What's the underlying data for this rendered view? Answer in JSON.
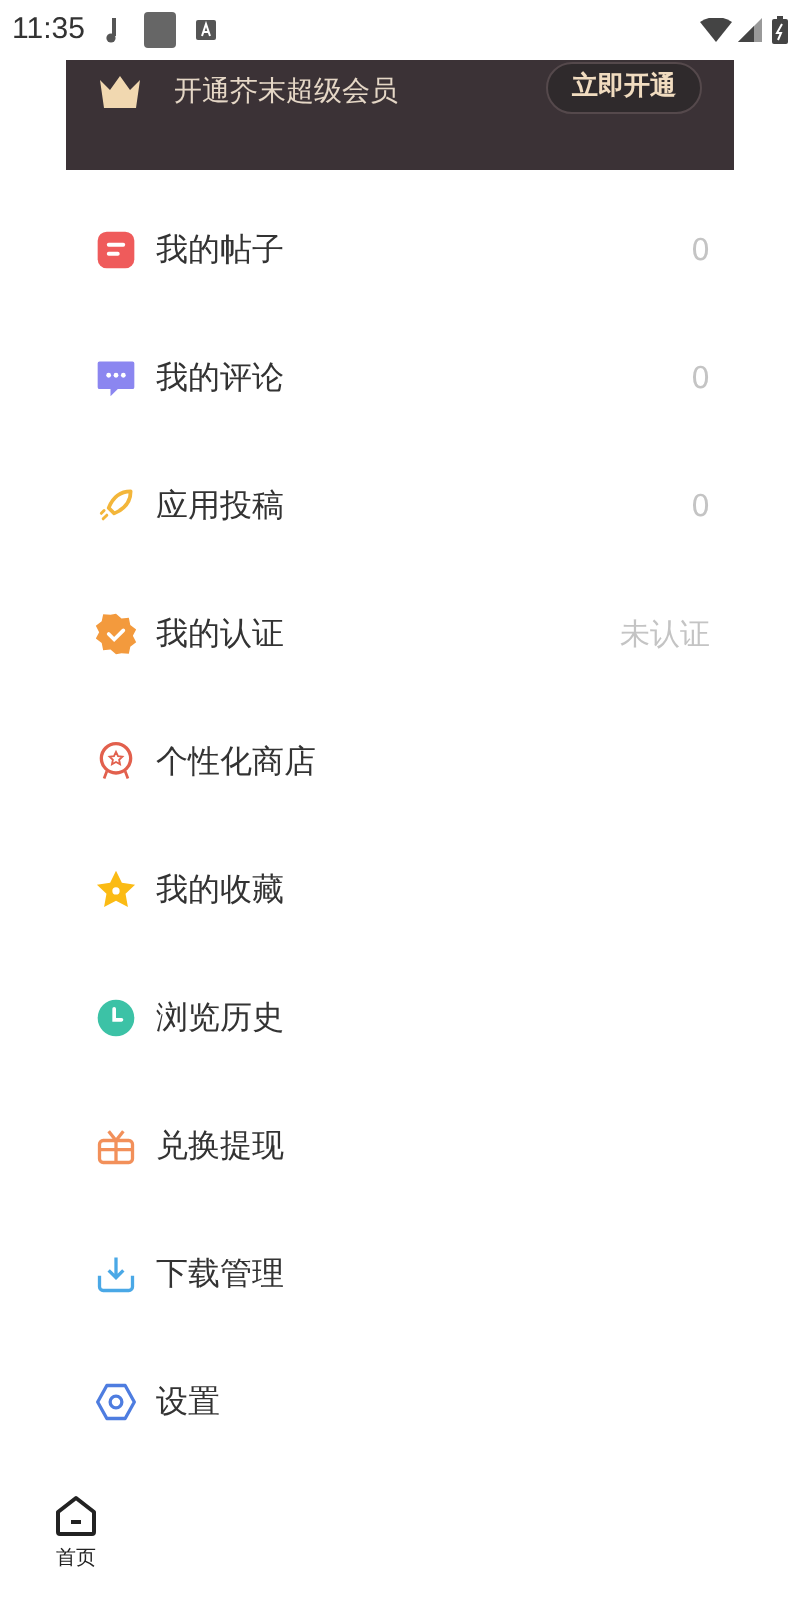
{
  "status_bar": {
    "time": "11:35"
  },
  "vip_banner": {
    "text": "开通芥末超级会员",
    "button": "立即开通"
  },
  "menu": [
    {
      "kind": "posts",
      "label": "我的帖子",
      "value": "0"
    },
    {
      "kind": "comments",
      "label": "我的评论",
      "value": "0"
    },
    {
      "kind": "submit",
      "label": "应用投稿",
      "value": "0"
    },
    {
      "kind": "verify",
      "label": "我的认证",
      "value": "未认证"
    },
    {
      "kind": "shop",
      "label": "个性化商店"
    },
    {
      "kind": "favorites",
      "label": "我的收藏"
    },
    {
      "kind": "history",
      "label": "浏览历史"
    },
    {
      "kind": "gift",
      "label": "兑换提现"
    },
    {
      "kind": "download",
      "label": "下载管理"
    },
    {
      "kind": "settings",
      "label": "设置"
    }
  ],
  "bottom_nav": [
    {
      "label": "首页",
      "selected": true
    }
  ]
}
